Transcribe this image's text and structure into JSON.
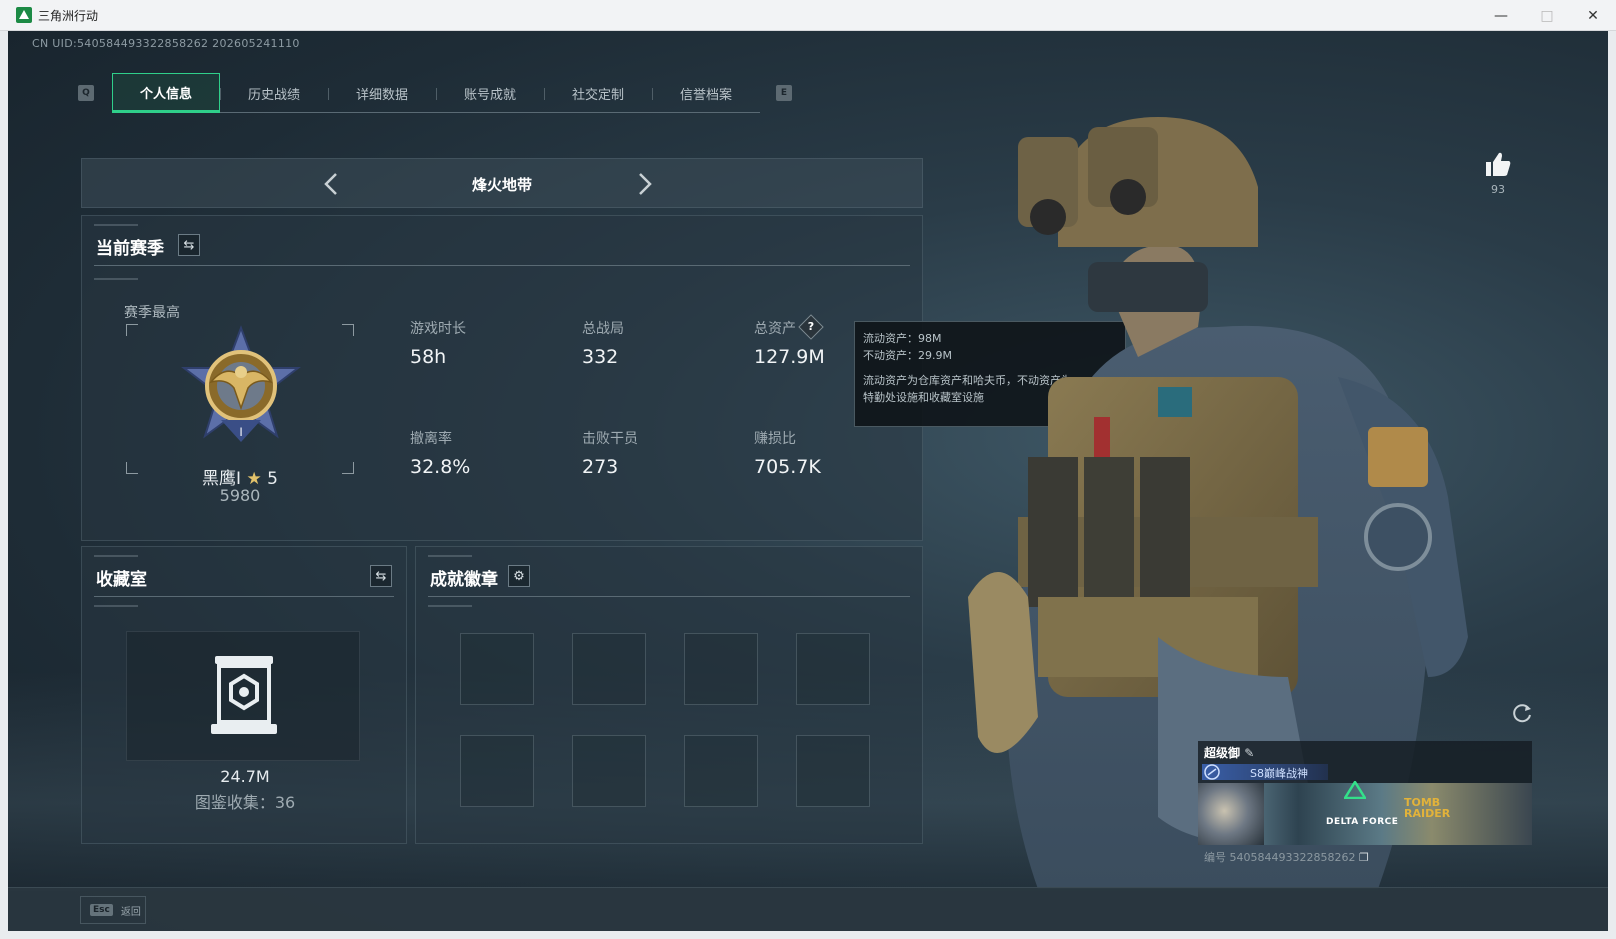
{
  "window": {
    "title": "三角洲行动"
  },
  "uid": "CN UID:540584493322858262 202605241110",
  "tabs": {
    "left_key": "Q",
    "right_key": "E",
    "items": [
      "个人信息",
      "历史战绩",
      "详细数据",
      "账号成就",
      "社交定制",
      "信誉档案"
    ]
  },
  "mode": {
    "title": "烽火地带"
  },
  "season": {
    "title": "当前赛季",
    "best_label": "赛季最高",
    "rank_name": "黑鹰I",
    "rank_stars": "5",
    "rank_score": "5980",
    "stats": [
      {
        "label": "游戏时长",
        "value": "58h"
      },
      {
        "label": "总战局",
        "value": "332"
      },
      {
        "label": "总资产",
        "value": "127.9M"
      },
      {
        "label": "撤离率",
        "value": "32.8%"
      },
      {
        "label": "击败干员",
        "value": "273"
      },
      {
        "label": "赚损比",
        "value": "705.7K"
      }
    ],
    "help_glyph": "?"
  },
  "tooltip": {
    "liquid": "流动资产：98M",
    "fixed": "不动资产：29.9M",
    "desc1": "流动资产为仓库资产和哈夫币，不动资产为",
    "desc2": "特勤处设施和收藏室设施"
  },
  "vault": {
    "title": "收藏室",
    "value": "24.7M",
    "collection": "图鉴收集：36"
  },
  "achievements": {
    "title": "成就徽章"
  },
  "likes": {
    "count": "93"
  },
  "card": {
    "name": "超级御",
    "title": "S8巅峰战神",
    "brand1": "DELTA FORCE",
    "brand2a": "TOMB",
    "brand2b": "RAIDER",
    "id": "编号 540584493322858262"
  },
  "bottom": {
    "esc_key": "Esc",
    "esc_label": "返回"
  },
  "colors": {
    "accent": "#2fcf8a",
    "background": "#1e2c36",
    "gold": "#c9a24a"
  }
}
